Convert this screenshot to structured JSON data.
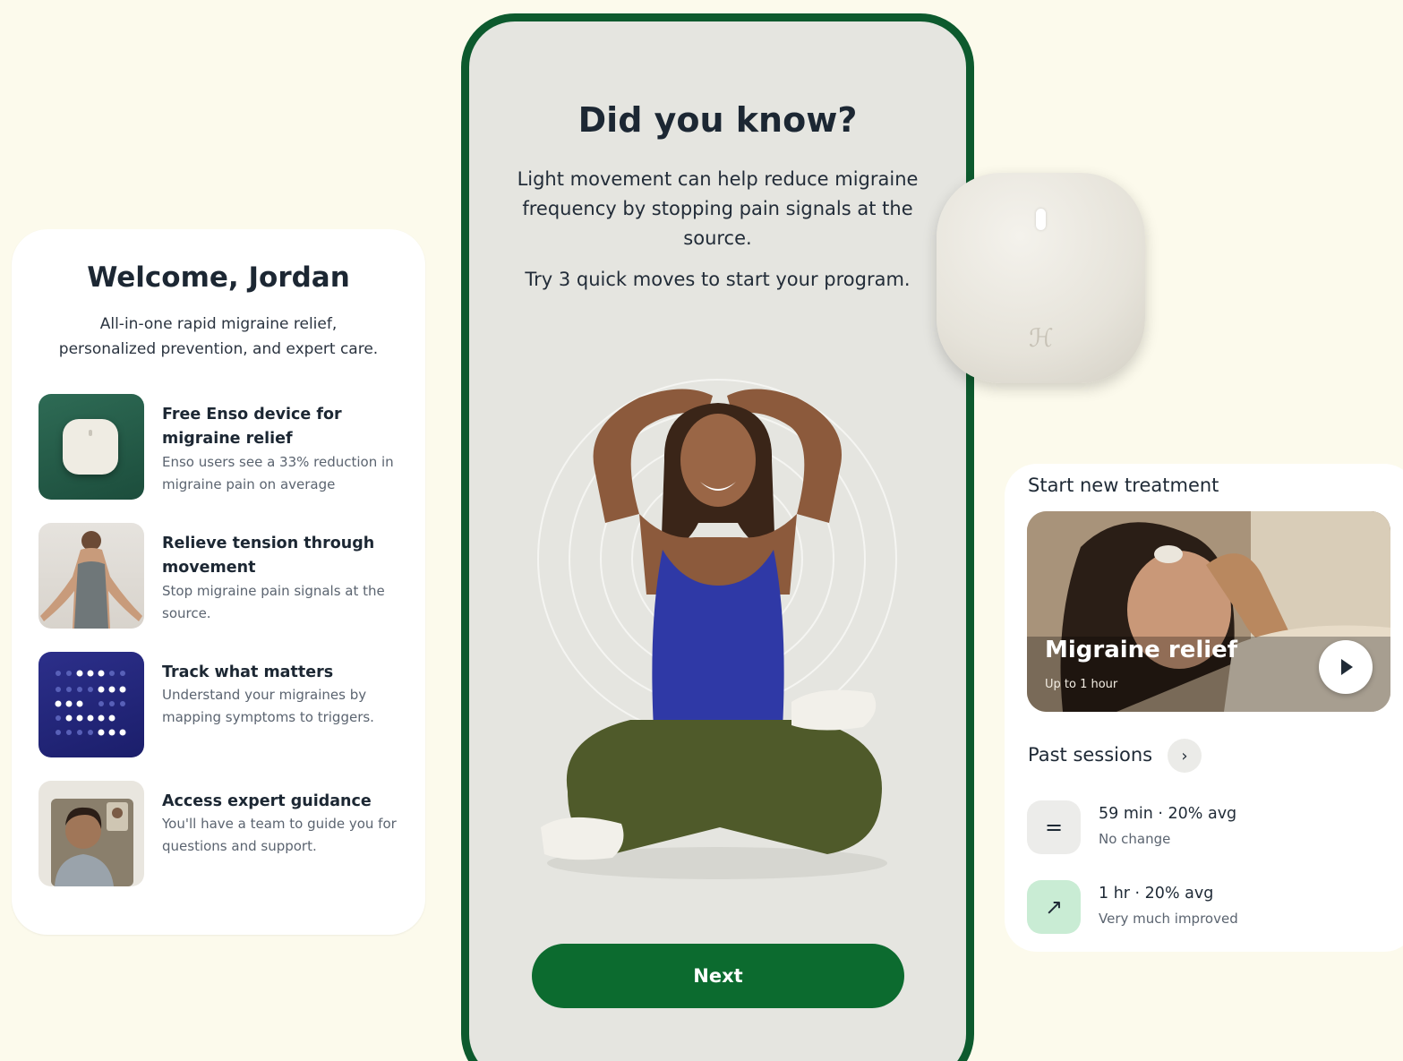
{
  "welcome": {
    "title": "Welcome, Jordan",
    "subtitle_line1": "All-in-one rapid migraine relief,",
    "subtitle_line2": "personalized prevention, and expert care.",
    "features": [
      {
        "title": "Free Enso device for migraine relief",
        "desc": "Enso users see a 33% reduction in migraine pain on average",
        "icon": "enso-device-icon"
      },
      {
        "title": "Relieve tension through movement",
        "desc": "Stop migraine pain signals at the source.",
        "icon": "movement-photo"
      },
      {
        "title": "Track what matters",
        "desc": "Understand your migraines by mapping symptoms to triggers.",
        "icon": "dot-grid-icon"
      },
      {
        "title": "Access expert guidance",
        "desc": "You'll have a team to guide you for questions and support.",
        "icon": "expert-photo"
      }
    ]
  },
  "phone": {
    "title": "Did you know?",
    "body": "Light movement can help reduce migraine frequency by stopping pain signals at the source.",
    "cta_text": "Try 3 quick moves to start your program.",
    "next_label": "Next",
    "accent_color": "#0c6b2f"
  },
  "treatment": {
    "heading": "Start new treatment",
    "video_title": "Migraine relief",
    "video_sub": "Up to 1 hour",
    "past_label": "Past sessions",
    "past_arrow": "›",
    "sessions": [
      {
        "main": "59 min · 20% avg",
        "sub": "No change",
        "icon": "equals-icon",
        "icon_glyph": "=",
        "icon_bg": "#ececea"
      },
      {
        "main": "1 hr · 20% avg",
        "sub": "Very much improved",
        "icon": "arrow-up-right-icon",
        "icon_glyph": "↗",
        "icon_bg": "#c9ecd4"
      }
    ]
  }
}
